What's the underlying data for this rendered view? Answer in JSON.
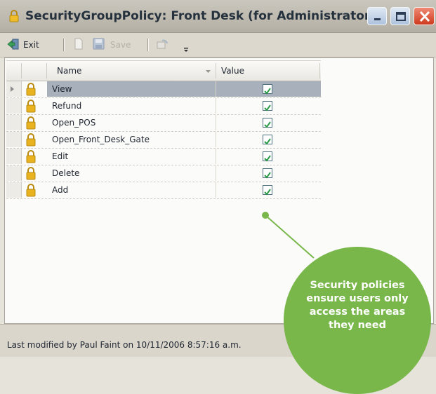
{
  "window": {
    "title": "SecurityGroupPolicy: Front Desk (for Administrator)"
  },
  "toolbar": {
    "exit_label": "Exit",
    "save_label": "Save"
  },
  "grid": {
    "columns": {
      "name": "Name",
      "value": "Value"
    },
    "rows": [
      {
        "name": "View",
        "value": true,
        "selected": true
      },
      {
        "name": "Refund",
        "value": true
      },
      {
        "name": "Open_POS",
        "value": true
      },
      {
        "name": "Open_Front_Desk_Gate",
        "value": true
      },
      {
        "name": "Edit",
        "value": true
      },
      {
        "name": "Delete",
        "value": true
      },
      {
        "name": "Add",
        "value": true
      }
    ]
  },
  "statusbar": {
    "text": "Last modified by Paul Faint on 10/11/2006 8:57:16 a.m."
  },
  "callout": {
    "text": "Security policies\nensure users only\naccess the areas\nthey need",
    "color": "#79b74a"
  },
  "colors": {
    "check": "#2a9a46",
    "lock": "#e9b320"
  }
}
